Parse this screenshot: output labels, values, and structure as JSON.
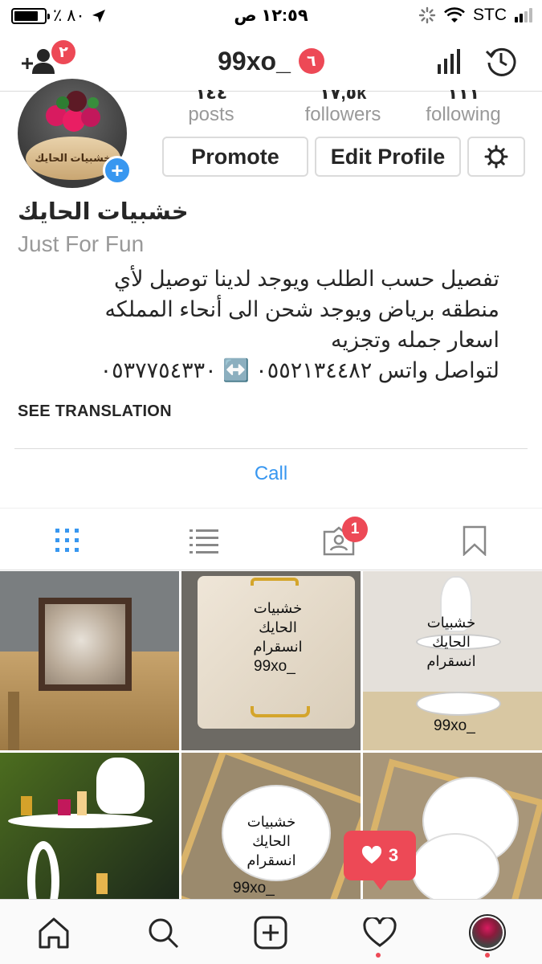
{
  "status_bar": {
    "battery_percent_text": "٪ ٨٠",
    "time": "١٢:٥٩ ص",
    "carrier": "STC"
  },
  "header": {
    "username": "99xo_",
    "requests_badge": "٢",
    "username_badge": "٦"
  },
  "profile": {
    "avatar_plaque_text": "خشبيات الحايك",
    "stats": [
      {
        "value": "١٤٤",
        "label": "posts"
      },
      {
        "value": "١٧,٥k",
        "label": "followers"
      },
      {
        "value": "١١١",
        "label": "following"
      }
    ],
    "buttons": {
      "promote": "Promote",
      "edit_profile": "Edit Profile"
    }
  },
  "bio": {
    "name": "خشبيات الحايك",
    "category": "Just For Fun",
    "lines": [
      "تفصيل حسب الطلب ويوجد لدينا توصيل لأي",
      "منطقه برياض ويوجد شحن الى أنحاء المملكه",
      "اسعار جمله وتجزيه",
      "لتواصل واتس ٠٥٥٢١٣٤٤٨٢ ↔️ ٠٥٣٧٧٥٤٣٣٠"
    ],
    "see_translation": "SEE TRANSLATION",
    "call": "Call"
  },
  "tabs": {
    "tagged_badge": "1"
  },
  "grid": {
    "cells": [
      {
        "ar": "",
        "en": ""
      },
      {
        "ar": "خشبيات\nالحايك\nانسقرام",
        "en": "99xo_"
      },
      {
        "ar": "خشبيات\nالحايك\nانسقرام",
        "en": "99xo_"
      },
      {
        "ar": "",
        "en": ""
      },
      {
        "ar": "خشبيات\nالحايك\nانسقرام",
        "en": "99xo_"
      },
      {
        "ar": "",
        "en": ""
      }
    ]
  },
  "like_popup": {
    "count": "3"
  },
  "colors": {
    "accent": "#3897f0",
    "badge": "#ed4956",
    "text": "#262626",
    "muted": "#999999"
  }
}
